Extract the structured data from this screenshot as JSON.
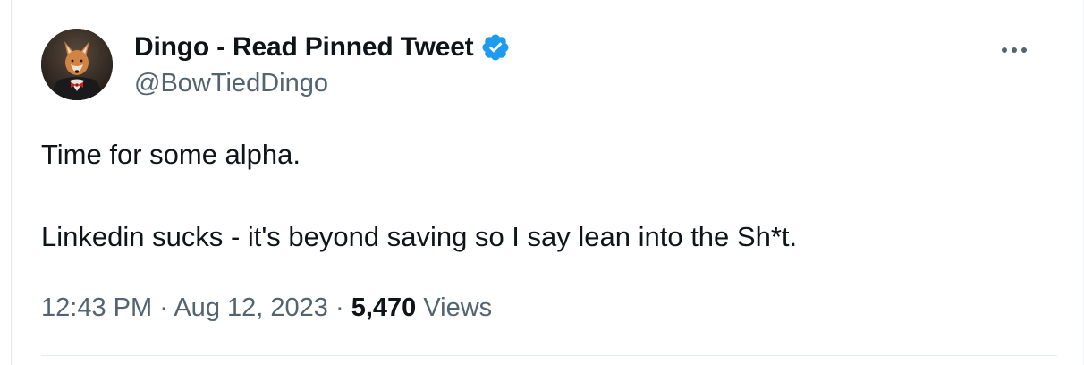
{
  "author": {
    "display_name": "Dingo - Read Pinned Tweet",
    "handle": "@BowTiedDingo",
    "verified_icon": "verified-badge-icon",
    "verified_color": "#1d9bf0"
  },
  "tweet": {
    "line1": "Time for some alpha.",
    "line2": "Linkedin sucks - it's beyond saving so I say lean into the Sh*t."
  },
  "meta": {
    "time": "12:43 PM",
    "separator": "·",
    "date": "Aug 12, 2023",
    "views_count": "5,470",
    "views_label": "Views"
  },
  "more_icon": "more-options-icon",
  "colors": {
    "text": "#0f1419",
    "secondary": "#536471",
    "divider": "#e6ecf0"
  }
}
